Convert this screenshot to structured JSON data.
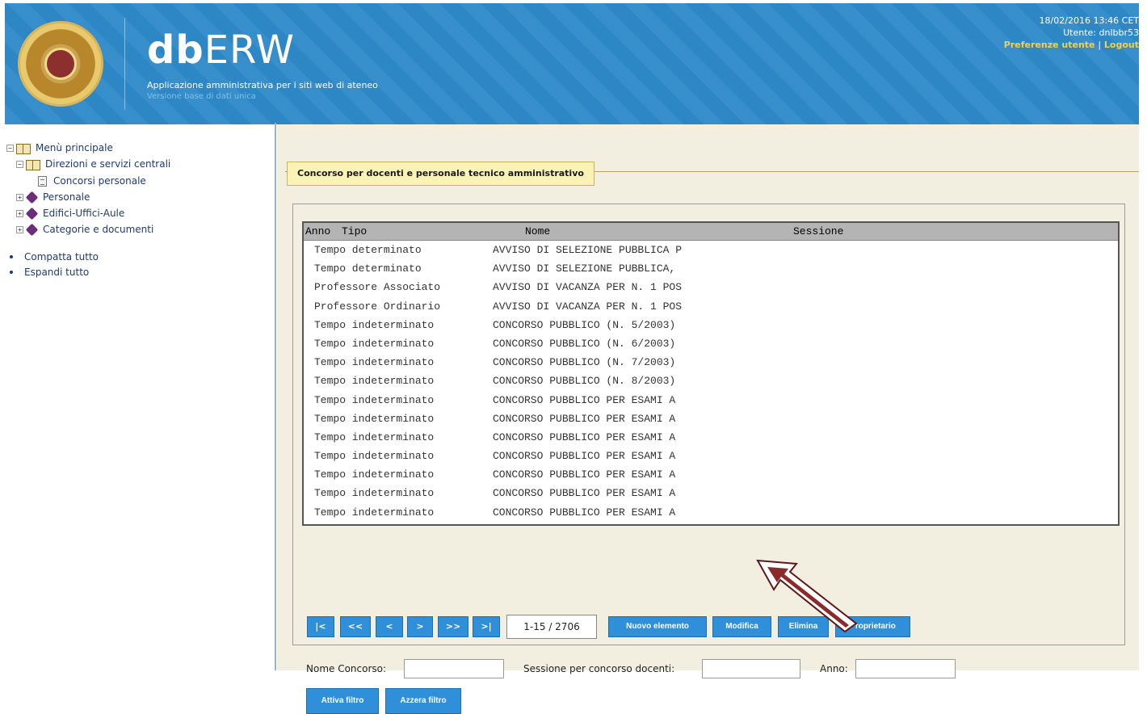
{
  "header": {
    "title_bold": "db",
    "title_light": "ERW",
    "subtitle": "Applicazione amministrativa per i siti web di ateneo",
    "version": "Versione base di dati unica",
    "datetime": "18/02/2016 13:46 CET",
    "user": "Utente: dnlbbr53",
    "prefs_link": "Preferenze utente",
    "logout_link": "Logout",
    "separator": "|"
  },
  "sidebar": {
    "root": "Menù principale",
    "direzioni": "Direzioni e servizi centrali",
    "concorsi": "Concorsi personale",
    "personale": "Personale",
    "edifici": "Edifici-Uffici-Aule",
    "categorie": "Categorie e documenti",
    "compatta": "Compatta tutto",
    "espandi": "Espandi tutto",
    "expanded_symbol": "−",
    "collapsed_symbol": "+"
  },
  "main": {
    "section_title": "Concorso per docenti e personale tecnico amministrativo",
    "columns": [
      "Anno",
      "Tipo",
      "Nome",
      "Sessione"
    ],
    "rows": [
      {
        "tipo": "Tempo determinato",
        "nome": "AVVISO DI SELEZIONE PUBBLICA P"
      },
      {
        "tipo": "Tempo determinato",
        "nome": "AVVISO DI SELEZIONE PUBBLICA,"
      },
      {
        "tipo": "Professore Associato",
        "nome": "AVVISO DI VACANZA PER N. 1 POS"
      },
      {
        "tipo": "Professore Ordinario",
        "nome": "AVVISO DI VACANZA PER N. 1 POS"
      },
      {
        "tipo": "Tempo indeterminato",
        "nome": "CONCORSO PUBBLICO (N. 5/2003)"
      },
      {
        "tipo": "Tempo indeterminato",
        "nome": "CONCORSO PUBBLICO (N. 6/2003)"
      },
      {
        "tipo": "Tempo indeterminato",
        "nome": "CONCORSO PUBBLICO (N. 7/2003)"
      },
      {
        "tipo": "Tempo indeterminato",
        "nome": "CONCORSO PUBBLICO (N. 8/2003)"
      },
      {
        "tipo": "Tempo indeterminato",
        "nome": "CONCORSO PUBBLICO PER ESAMI A"
      },
      {
        "tipo": "Tempo indeterminato",
        "nome": "CONCORSO PUBBLICO PER ESAMI A"
      },
      {
        "tipo": "Tempo indeterminato",
        "nome": "CONCORSO PUBBLICO PER ESAMI A"
      },
      {
        "tipo": "Tempo indeterminato",
        "nome": "CONCORSO PUBBLICO PER ESAMI A"
      },
      {
        "tipo": "Tempo indeterminato",
        "nome": "CONCORSO PUBBLICO PER ESAMI A"
      },
      {
        "tipo": "Tempo indeterminato",
        "nome": "CONCORSO PUBBLICO PER ESAMI A"
      },
      {
        "tipo": "Tempo indeterminato",
        "nome": "CONCORSO PUBBLICO PER ESAMI A"
      }
    ],
    "pager": {
      "first": "|<",
      "prev_page": "<<",
      "prev": "<",
      "next": ">",
      "next_page": ">>",
      "last": ">|",
      "range": "1-15 / 2706"
    },
    "buttons": {
      "new": "Nuovo elemento",
      "edit": "Modifica",
      "delete": "Elimina",
      "owner": "Proprietario",
      "apply_filter": "Attiva filtro",
      "reset_filter": "Azzera filtro"
    },
    "filters": {
      "nome_label": "Nome Concorso:",
      "sessione_label": "Sessione per concorso docenti:",
      "anno_label": "Anno:",
      "nome_value": "",
      "sessione_value": "",
      "anno_value": ""
    }
  },
  "colors": {
    "header_bg": "#2f8ac9",
    "button_bg": "#2f8fd8",
    "content_bg": "#f2efe1",
    "annotation_arrow": "#8b2a2a",
    "link_yellow": "#f5d142"
  }
}
